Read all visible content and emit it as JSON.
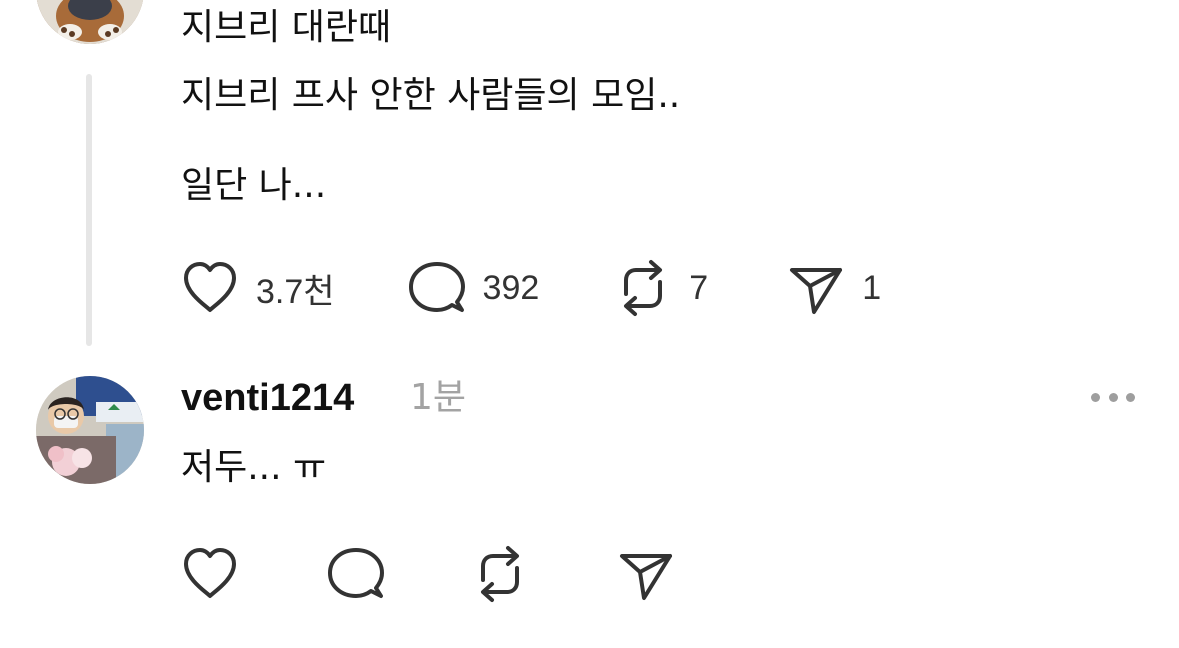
{
  "post": {
    "line1": "지브리 대란때",
    "line2": "지브리 프사 안한 사람들의 모임..",
    "line3": "일단 나...",
    "like_count": "3.7천",
    "comment_count": "392",
    "repost_count": "7",
    "share_count": "1"
  },
  "reply": {
    "username": "venti1214",
    "time": "1분",
    "text": "저두... ㅠ"
  },
  "icons": {
    "like": "heart-icon",
    "comment": "comment-bubble-icon",
    "repost": "repost-icon",
    "share": "send-icon",
    "more": "more-dots-icon"
  }
}
